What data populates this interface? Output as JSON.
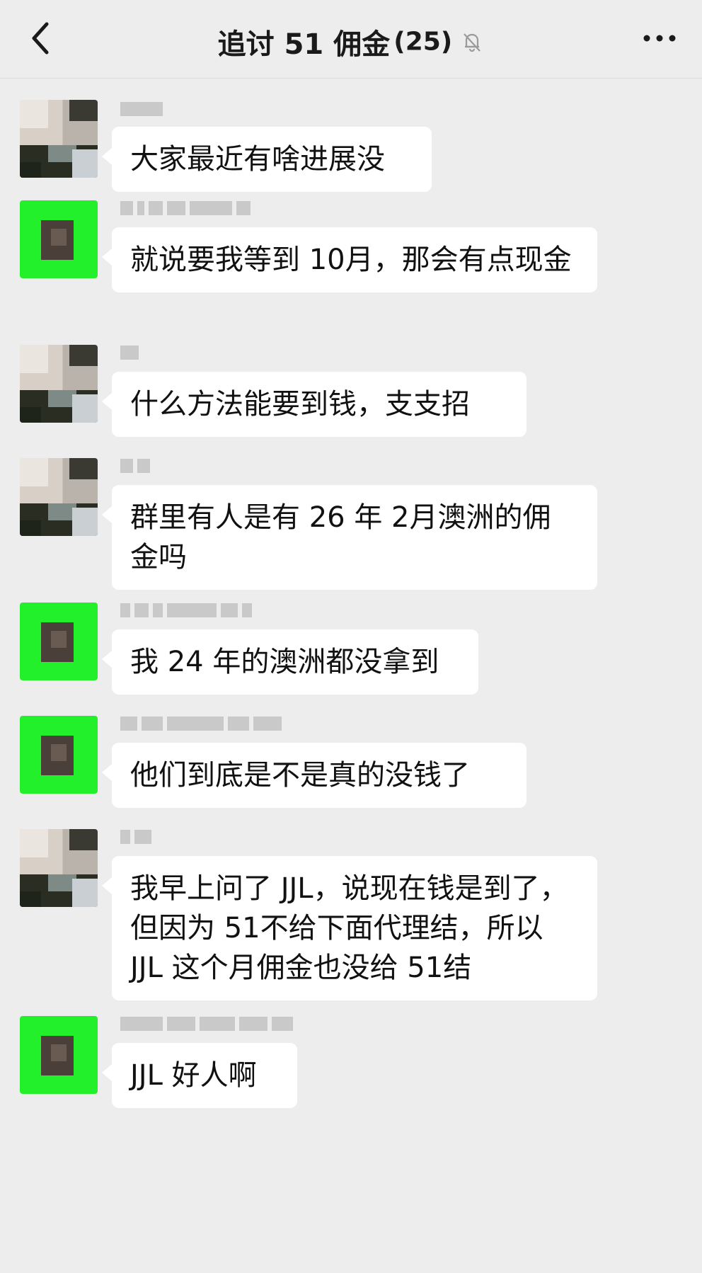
{
  "header": {
    "title": "追讨 51 佣金",
    "member_count": "(25)",
    "icons": {
      "back": "chevron-left-icon",
      "mute": "bell-off-icon",
      "more": "more-dots-icon"
    }
  },
  "messages": [
    {
      "avatar": "photo",
      "text": "大家最近有啥进展没"
    },
    {
      "avatar": "green",
      "text": "就说要我等到 10月，那会有点现金"
    },
    {
      "avatar": "photo",
      "text": "什么方法能要到钱，支支招"
    },
    {
      "avatar": "photo",
      "text": "群里有人是有 26 年 2月澳洲的佣金吗"
    },
    {
      "avatar": "green",
      "text": "我 24 年的澳洲都没拿到"
    },
    {
      "avatar": "green",
      "text": "他们到底是不是真的没钱了"
    },
    {
      "avatar": "photo",
      "text": "我早上问了 JJL，说现在钱是到了，但因为 51不给下面代理结，所以 JJL 这个月佣金也没给 51结"
    },
    {
      "avatar": "green",
      "text": "JJL 好人啊"
    }
  ]
}
